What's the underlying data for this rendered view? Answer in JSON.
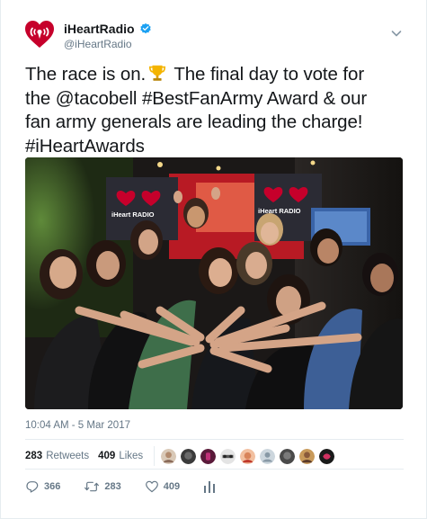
{
  "tweet": {
    "display_name": "iHeartRadio",
    "handle": "@iHeartRadio",
    "verified": true,
    "text_lines": [
      "The race is on.",
      " The final day to vote for",
      "the @tacobell #BestFanArmy  Award & our",
      "fan army generals are leading the charge!",
      "#iHeartAwards"
    ],
    "timestamp": "10:04 AM - 5 Mar 2017",
    "photo": {
      "sign_text": "iHeart RADIO"
    },
    "stats": {
      "retweets_count": "283",
      "retweets_label": "Retweets",
      "likes_count": "409",
      "likes_label": "Likes"
    },
    "actions": {
      "reply_count": "366",
      "retweet_count": "283",
      "like_count": "409"
    }
  },
  "icons": {
    "logo": "iheartradio-logo-icon",
    "verified": "verified-badge-icon",
    "caret": "chevron-down-icon",
    "trophy": "trophy-icon",
    "reply": "reply-icon",
    "retweet": "retweet-icon",
    "like": "heart-icon",
    "analytics": "analytics-icon"
  },
  "colors": {
    "brand_red": "#c6002b",
    "verified_blue": "#1da1f2",
    "muted": "#657786",
    "text": "#14171a"
  }
}
